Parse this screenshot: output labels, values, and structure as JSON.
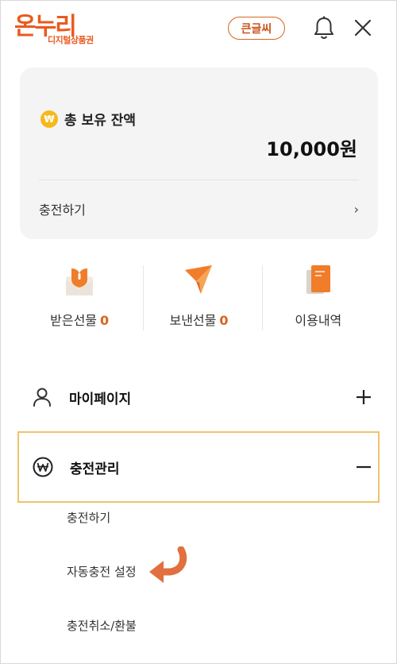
{
  "header": {
    "logo_main": "온누리",
    "logo_sub": "디지털상품권",
    "large_text_button": "큰글씨"
  },
  "balance_card": {
    "currency_symbol": "₩",
    "title": "총 보유 잔액",
    "amount": "10,000원",
    "charge_link": "충전하기",
    "chevron": "›"
  },
  "quick_menu": [
    {
      "label": "받은선물",
      "count": "0",
      "icon": "gift-received-icon"
    },
    {
      "label": "보낸선물",
      "count": "0",
      "icon": "gift-sent-icon"
    },
    {
      "label": "이용내역",
      "count": "",
      "icon": "history-icon"
    }
  ],
  "menu": {
    "mypage": {
      "label": "마이페이지",
      "state": "collapsed"
    },
    "charge_management": {
      "label": "충전관리",
      "state": "expanded",
      "items": [
        "충전하기",
        "자동충전 설정",
        "충전취소/환불"
      ]
    }
  },
  "colors": {
    "brand_orange": "#ea5a1e",
    "highlight_border": "#efc46a",
    "coin_yellow": "#f5b91c",
    "arrow_hint": "#e0703f"
  }
}
